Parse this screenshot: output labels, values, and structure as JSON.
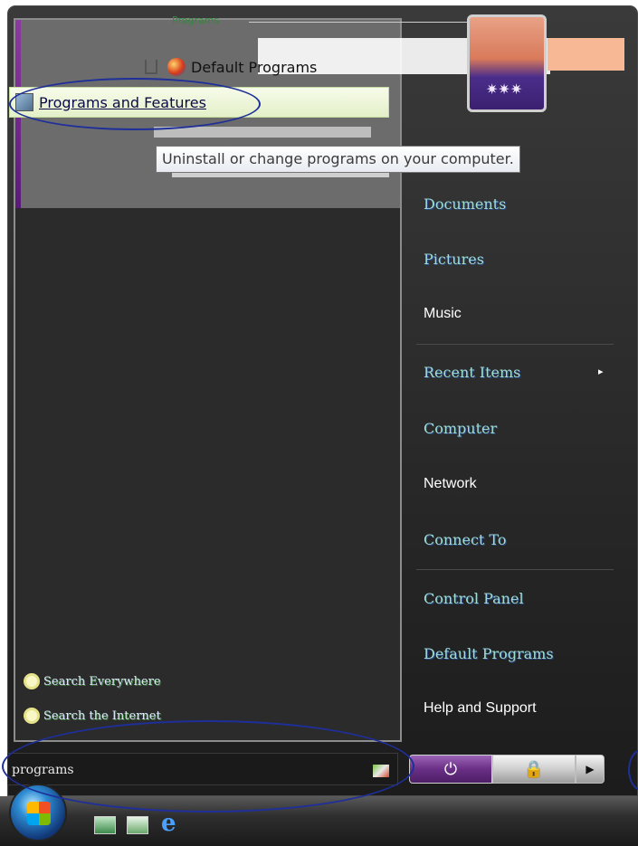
{
  "results": {
    "header_label": "Programs",
    "items": [
      {
        "label": "Default Programs",
        "icon": "globe-icon"
      },
      {
        "label": "Programs and Features",
        "icon": "control-panel-icon"
      }
    ],
    "tooltip": "Uninstall or change programs on your computer."
  },
  "search_links": {
    "everywhere": "Search Everywhere",
    "internet": "Search the Internet"
  },
  "search": {
    "value": "programs"
  },
  "right_pane": {
    "items": {
      "documents": "Documents",
      "pictures": "Pictures",
      "music": "Music",
      "recent": "Recent Items",
      "computer": "Computer",
      "network": "Network",
      "connect": "Connect To",
      "control_panel": "Control Panel",
      "default_programs": "Default Programs",
      "help": "Help and Support"
    }
  },
  "buttons": {
    "power_glyph": "⏻",
    "lock_glyph": "🔒",
    "arrow_glyph": "▶"
  },
  "taskbar": {
    "ie_glyph": "e"
  },
  "colors": {
    "accent": "#6a2f86",
    "highlight": "#e3f0c8",
    "annotation": "#1e2f9a"
  }
}
